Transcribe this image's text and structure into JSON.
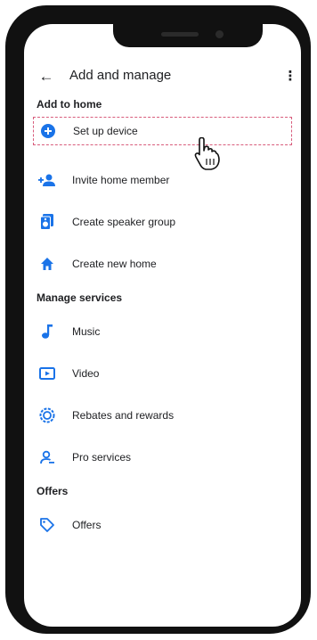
{
  "header": {
    "title": "Add and manage"
  },
  "sections": {
    "add_to_home": {
      "title": "Add to home",
      "items": [
        {
          "label": "Set up device",
          "icon": "add-circle-icon"
        },
        {
          "label": "Invite home member",
          "icon": "person-add-icon"
        },
        {
          "label": "Create speaker group",
          "icon": "speaker-group-icon"
        },
        {
          "label": "Create new home",
          "icon": "home-icon"
        }
      ]
    },
    "manage_services": {
      "title": "Manage services",
      "items": [
        {
          "label": "Music",
          "icon": "music-note-icon"
        },
        {
          "label": "Video",
          "icon": "video-icon"
        },
        {
          "label": "Rebates and rewards",
          "icon": "rebates-icon"
        },
        {
          "label": "Pro services",
          "icon": "pro-services-icon"
        }
      ]
    },
    "offers": {
      "title": "Offers",
      "items": [
        {
          "label": "Offers",
          "icon": "tag-icon"
        }
      ]
    }
  },
  "colors": {
    "accent": "#1a73e8",
    "highlight_border": "#d85c7c",
    "frame": "#111111"
  }
}
